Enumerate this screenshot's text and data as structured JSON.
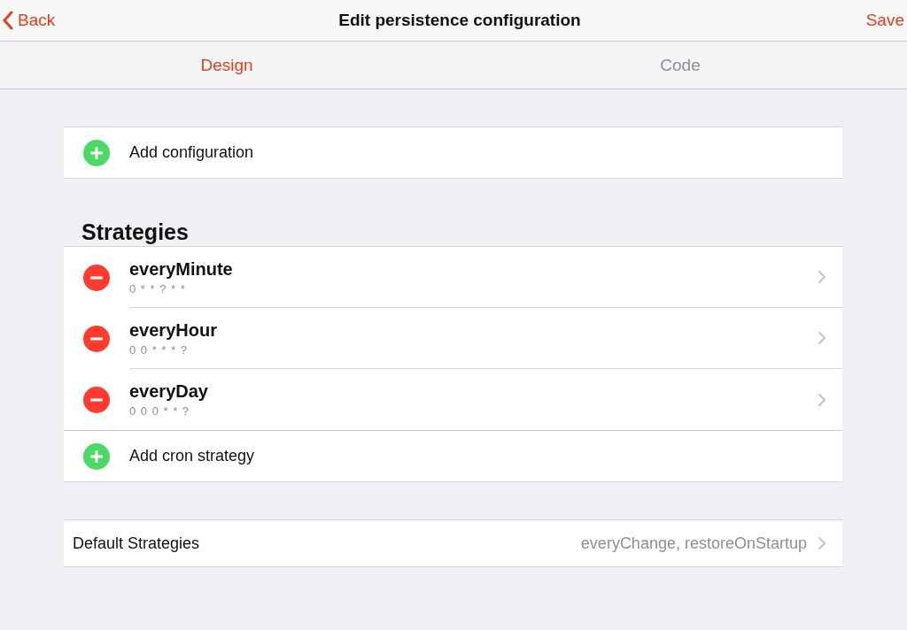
{
  "nav": {
    "back": "Back",
    "title": "Edit persistence configuration",
    "save": "Save"
  },
  "tabs": [
    {
      "label": "Design",
      "selected": true
    },
    {
      "label": "Code",
      "selected": false
    }
  ],
  "add_configuration": "Add configuration",
  "strategies": {
    "heading": "Strategies",
    "items": [
      {
        "name": "everyMinute",
        "cron": "0 * * ? * *"
      },
      {
        "name": "everyHour",
        "cron": "0 0 * * * ?"
      },
      {
        "name": "everyDay",
        "cron": "0 0 0 * * ?"
      }
    ],
    "add": "Add cron strategy"
  },
  "default_strategies": {
    "label": "Default Strategies",
    "value": "everyChange, restoreOnStartup"
  }
}
